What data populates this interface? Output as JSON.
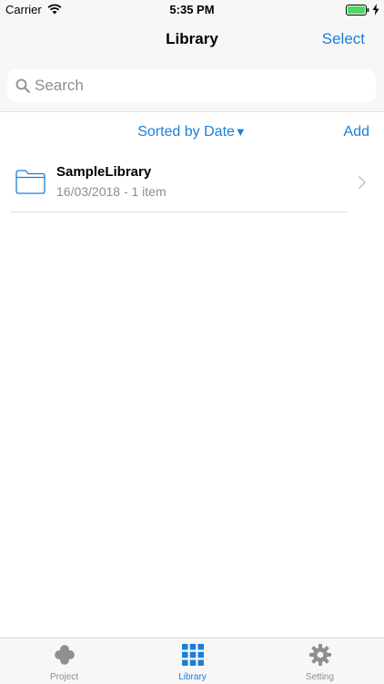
{
  "status_bar": {
    "carrier": "Carrier",
    "time": "5:35 PM"
  },
  "nav": {
    "title": "Library",
    "select_label": "Select"
  },
  "search": {
    "placeholder": "Search",
    "value": ""
  },
  "toolbar": {
    "sort_label": "Sorted by Date",
    "sort_arrow": "▼",
    "add_label": "Add"
  },
  "library_items": [
    {
      "name": "SampleLibrary",
      "meta": "16/03/2018 - 1 item"
    }
  ],
  "tab_bar": {
    "tabs": [
      {
        "label": "Project",
        "icon": "clover-icon",
        "selected": false
      },
      {
        "label": "Library",
        "icon": "grid-icon",
        "selected": true
      },
      {
        "label": "Setting",
        "icon": "gear-icon",
        "selected": false
      }
    ]
  },
  "colors": {
    "accent": "#1a7fd9",
    "battery": "#4cd964",
    "inactive": "#8e8e93",
    "bar_background": "#f7f7f7"
  }
}
